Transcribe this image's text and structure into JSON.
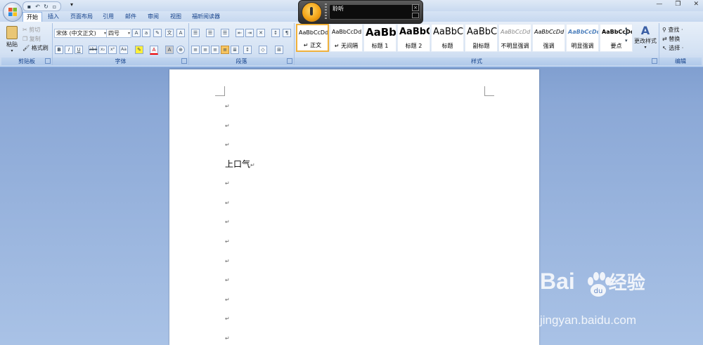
{
  "title_bar": {
    "qat_icons": [
      "save-icon",
      "undo-icon",
      "redo-icon",
      "print-preview-icon",
      "customize-icon"
    ],
    "window_controls": [
      "—",
      "❐",
      "✕"
    ]
  },
  "tabs": [
    "开始",
    "插入",
    "页面布局",
    "引用",
    "邮件",
    "审阅",
    "视图",
    "福昕阅读器"
  ],
  "clipboard": {
    "paste": "粘贴",
    "cut": "剪切",
    "copy": "复制",
    "format_painter": "格式刷",
    "label": "剪贴板"
  },
  "font": {
    "name": "宋体 (中文正文)",
    "size": "四号",
    "label": "字体",
    "bold": "B",
    "italic": "I",
    "underline": "U",
    "strike": "abe",
    "sub": "x₂",
    "sup": "x²",
    "case": "Aa"
  },
  "paragraph": {
    "label": "段落"
  },
  "styles": {
    "label": "样式",
    "items": [
      {
        "sample": "AaBbCcDd",
        "name": "↵ 正文"
      },
      {
        "sample": "AaBbCcDd",
        "name": "↵ 无间隔"
      },
      {
        "sample": "AaBb",
        "name": "标题 1"
      },
      {
        "sample": "AaBbC",
        "name": "标题 2"
      },
      {
        "sample": "AaBbC",
        "name": "标题"
      },
      {
        "sample": "AaBbC",
        "name": "副标题"
      },
      {
        "sample": "AaBbCcDd",
        "name": "不明显强调"
      },
      {
        "sample": "AaBbCcDd",
        "name": "强调"
      },
      {
        "sample": "AaBbCcDd",
        "name": "明显强调"
      },
      {
        "sample": "AaBbCcDc",
        "name": "要点"
      }
    ],
    "change_styles": "更改样式"
  },
  "editing": {
    "find": "查找 ·",
    "replace": "替换",
    "select": "选择 ·",
    "label": "编辑"
  },
  "speech": {
    "status": "聆听"
  },
  "document": {
    "text": "上口气",
    "para_mark": "↵"
  },
  "watermark": {
    "brand": "Bai",
    "brand2": "经验",
    "url": "jingyan.baidu.com"
  }
}
